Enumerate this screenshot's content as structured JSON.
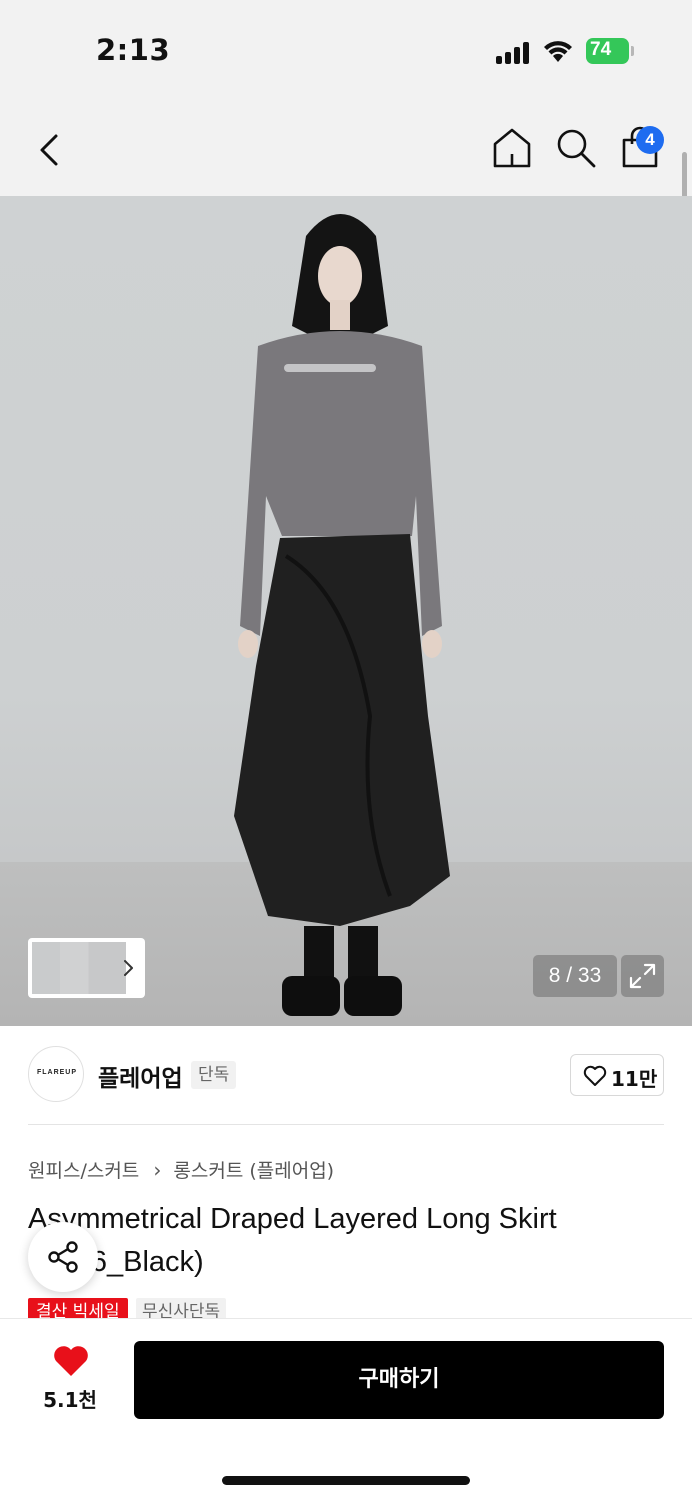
{
  "status_bar": {
    "time": "2:13",
    "battery": "74",
    "battery_color": "#34c759"
  },
  "nav": {
    "back_icon": "chevron-left-icon",
    "home_icon": "home-icon",
    "search_icon": "search-icon",
    "bag_icon": "shopping-bag-icon",
    "bag_count": "4",
    "badge_color": "#1e6cf0"
  },
  "gallery": {
    "counter": "8 / 33",
    "expand_icon": "expand-icon",
    "thumbs_chevron": "chevron-right-icon"
  },
  "brand": {
    "logo_text": "FLAREUP",
    "name": "플레어업",
    "tag": "단독",
    "like_count": "11만"
  },
  "breadcrumb": {
    "level1": "원피스/스커트",
    "separator_icon": "chevron-right-icon",
    "level2": "롱스커트 (플레어업)"
  },
  "product": {
    "title": "Asymmetrical Draped Layered Long Skirt (FLS6_Black)",
    "badges": [
      "결산 빅세일",
      "무신사단독"
    ],
    "sale_color": "#e8101a"
  },
  "share": {
    "icon": "share-icon"
  },
  "bottom": {
    "wish_count": "5.1천",
    "wish_icon": "heart-icon",
    "wish_color": "#e8101a",
    "buy_label": "구매하기"
  }
}
